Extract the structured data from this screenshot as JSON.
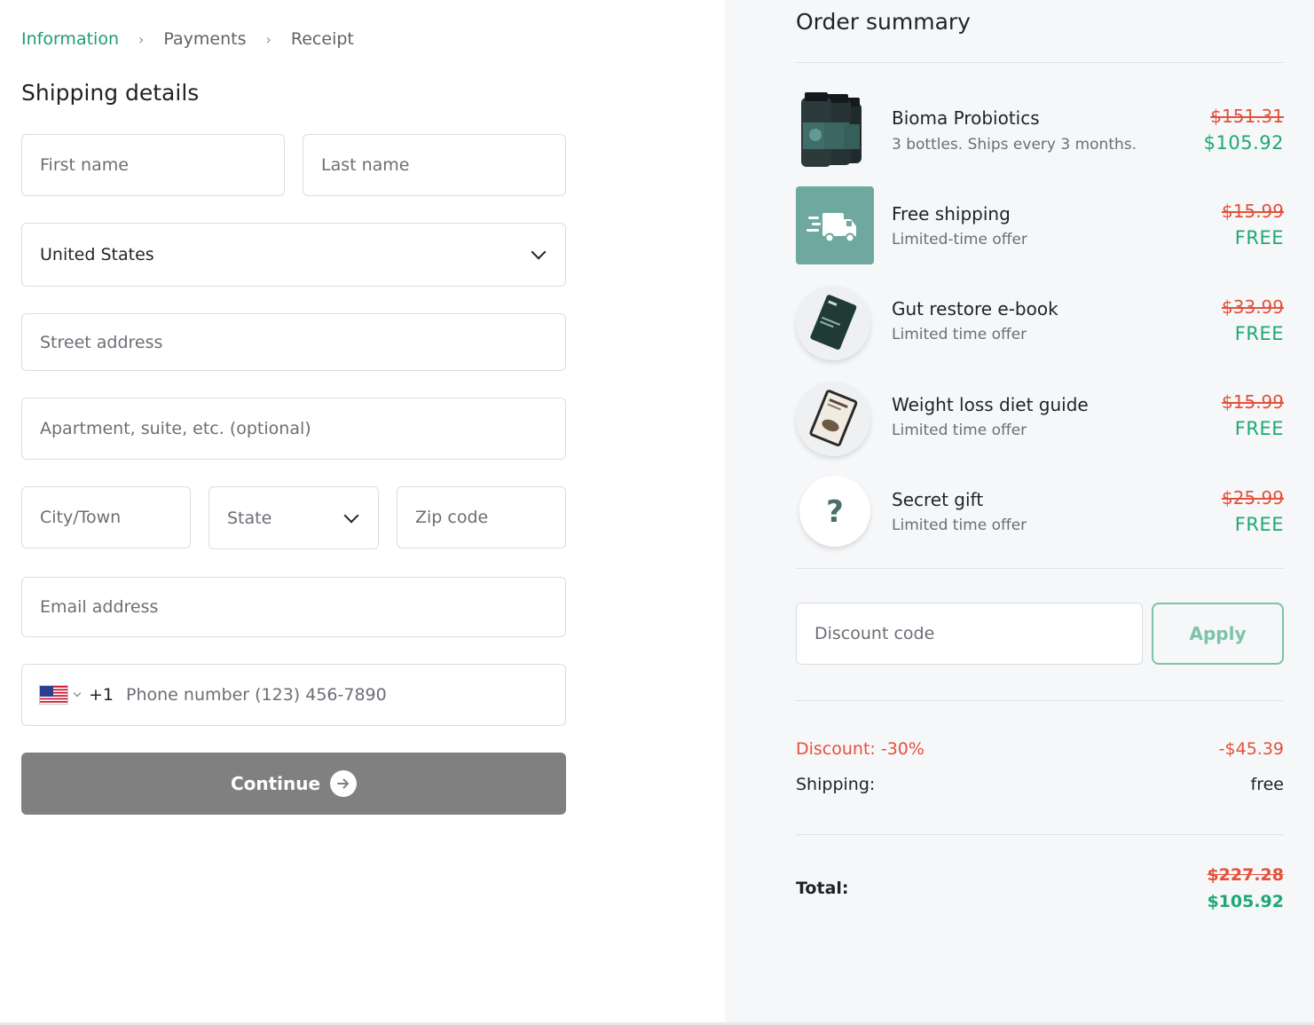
{
  "breadcrumb": {
    "items": [
      {
        "label": "Information"
      },
      {
        "label": "Payments"
      },
      {
        "label": "Receipt"
      }
    ],
    "active_color": "#1f9d6b"
  },
  "shipping": {
    "title": "Shipping details",
    "first_name": {
      "placeholder": "First name",
      "value": ""
    },
    "last_name": {
      "placeholder": "Last name",
      "value": ""
    },
    "country": {
      "value": "United States"
    },
    "street": {
      "placeholder": "Street address",
      "value": ""
    },
    "apartment": {
      "placeholder": "Apartment, suite, etc. (optional)",
      "value": ""
    },
    "city": {
      "placeholder": "City/Town",
      "value": ""
    },
    "state": {
      "placeholder": "State",
      "value": ""
    },
    "zip": {
      "placeholder": "Zip code",
      "value": ""
    },
    "email": {
      "placeholder": "Email address",
      "value": ""
    },
    "phone": {
      "country_flag": "us-flag-icon",
      "dial_code": "+1",
      "placeholder": "Phone number (123) 456-7890",
      "value": ""
    },
    "continue_label": "Continue",
    "continue_color": "#808080"
  },
  "summary": {
    "title": "Order summary",
    "items": [
      {
        "name": "Bioma Probiotics",
        "sub": "3 bottles. Ships every 3 months.",
        "old_price": "$151.31",
        "new_price": "$105.92",
        "icon": "probiotic-bottles-image"
      },
      {
        "name": "Free shipping",
        "sub": "Limited-time offer",
        "old_price": "$15.99",
        "new_price": "FREE",
        "icon": "delivery-truck-icon"
      },
      {
        "name": "Gut restore e-book",
        "sub": "Limited time offer",
        "old_price": "$33.99",
        "new_price": "FREE",
        "icon": "ebook-tablet-image"
      },
      {
        "name": "Weight loss diet guide",
        "sub": "Limited time offer",
        "old_price": "$15.99",
        "new_price": "FREE",
        "icon": "diet-guide-tablet-image"
      },
      {
        "name": "Secret gift",
        "sub": "Limited time offer",
        "old_price": "$25.99",
        "new_price": "FREE",
        "icon": "question-mark-icon"
      }
    ],
    "discount": {
      "placeholder": "Discount code",
      "value": "",
      "apply_label": "Apply"
    },
    "discount_row": {
      "label": "Discount: -30%",
      "value": "-$45.39"
    },
    "shipping_row": {
      "label": "Shipping:",
      "value": "free"
    },
    "total": {
      "label": "Total:",
      "old": "$227.28",
      "new": "$105.92"
    },
    "colors": {
      "strike": "#e4513a",
      "price": "#1fa874",
      "panel_bg": "#f6f7f9",
      "accent_tile": "#6fa89e"
    }
  }
}
